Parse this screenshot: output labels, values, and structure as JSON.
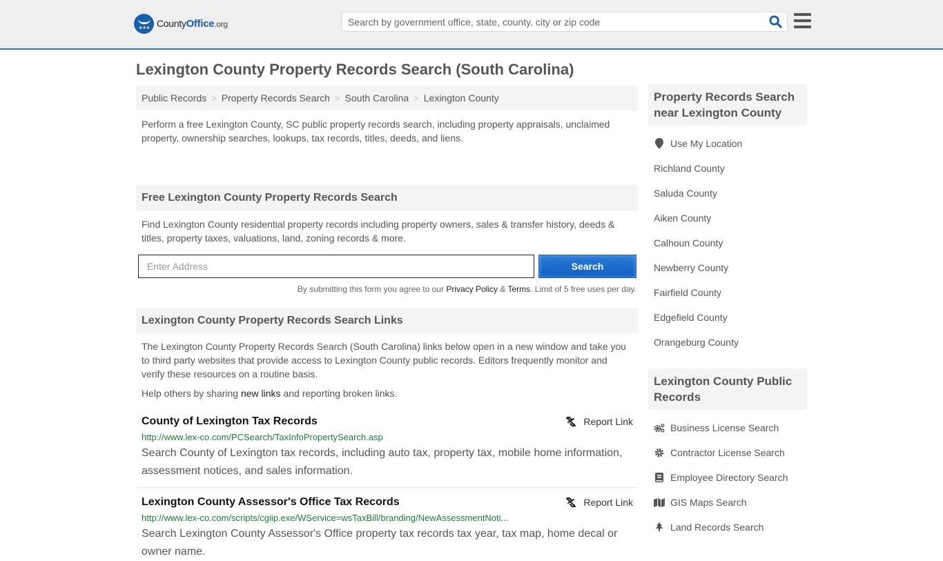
{
  "header": {
    "logo": {
      "county": "County",
      "office": "Office",
      "org": ".org"
    },
    "search_placeholder": "Search by government office, state, county, city or zip code"
  },
  "page_title": "Lexington County Property Records Search (South Carolina)",
  "breadcrumb": [
    "Public Records",
    "Property Records Search",
    "South Carolina",
    "Lexington County"
  ],
  "intro": "Perform a free Lexington County, SC public property records search, including property appraisals, unclaimed property, ownership searches, lookups, tax records, titles, deeds, and liens.",
  "free_search": {
    "heading": "Free Lexington County Property Records Search",
    "description": "Find Lexington County residential property records including property owners, sales & transfer history, deeds & titles, property taxes, valuations, land, zoning records & more.",
    "address_placeholder": "Enter Address",
    "button_label": "Search",
    "disclaimer_prefix": "By submitting this form you agree to our ",
    "privacy_label": "Privacy Policy",
    "amp": " & ",
    "terms_label": "Terms",
    "disclaimer_suffix": ". Limit of 5 free uses per day."
  },
  "links_section": {
    "heading": "Lexington County Property Records Search Links",
    "description": "The Lexington County Property Records Search (South Carolina) links below open in a new window and take you to third party websites that provide access to Lexington County public records. Editors frequently monitor and verify these resources on a routine basis.",
    "help_prefix": "Help others by sharing ",
    "help_link": "new links",
    "help_suffix": " and reporting broken links.",
    "report_label": "Report Link",
    "records": [
      {
        "title": "County of Lexington Tax Records",
        "url": "http://www.lex-co.com/PCSearch/TaxInfoPropertySearch.asp",
        "description": "Search County of Lexington tax records, including auto tax, property tax, mobile home information, assessment notices, and sales information."
      },
      {
        "title": "Lexington County Assessor's Office Tax Records",
        "url": "http://www.lex-co.com/scripts/cgiip.exe/WService=wsTaxBill/branding/NewAssessmentNoti...",
        "description": "Search Lexington County Assessor's Office property tax records tax year, tax map, home decal or owner name."
      }
    ]
  },
  "sidebar": {
    "nearby": {
      "heading": "Property Records Search near Lexington County",
      "use_location": "Use My Location",
      "counties": [
        "Richland County",
        "Saluda County",
        "Aiken County",
        "Calhoun County",
        "Newberry County",
        "Fairfield County",
        "Edgefield County",
        "Orangeburg County"
      ]
    },
    "public_records": {
      "heading": "Lexington County Public Records",
      "items": [
        {
          "label": "Business License Search",
          "icon": "cogs-icon"
        },
        {
          "label": "Contractor License Search",
          "icon": "gear-icon"
        },
        {
          "label": "Employee Directory Search",
          "icon": "book-icon"
        },
        {
          "label": "GIS Maps Search",
          "icon": "map-icon"
        },
        {
          "label": "Land Records Search",
          "icon": "tree-icon"
        }
      ]
    }
  }
}
